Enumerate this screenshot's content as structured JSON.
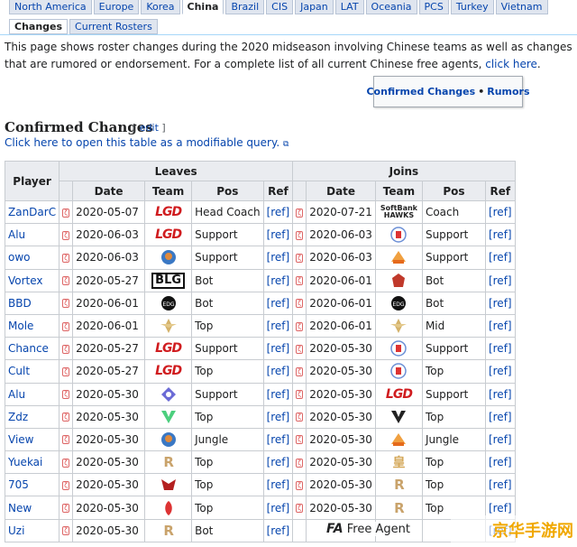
{
  "region_tabs": [
    "North America",
    "Europe",
    "Korea",
    "China",
    "Brazil",
    "CIS",
    "Japan",
    "LAT",
    "Oceania",
    "PCS",
    "Turkey",
    "Vietnam"
  ],
  "active_region": "China",
  "sub_tabs": [
    "Changes",
    "Current Rosters"
  ],
  "intro": {
    "text": "This page shows roster changes during the 2020 midseason involving Chinese teams as well as changes that are rumored or endorsement. For a complete list of all current Chinese free agents,",
    "link": "click here",
    "end": "."
  },
  "quicklinks": {
    "confirmed": "Confirmed Changes",
    "separator": "•",
    "rumors": "Rumors"
  },
  "section": {
    "title": "Confirmed Changes",
    "edit_open": "[",
    "edit": "edit",
    "edit_close": "]"
  },
  "query_link": "Click here to open this table as a modifiable query.",
  "table": {
    "player_header": "Player",
    "leaves_header": "Leaves",
    "joins_header": "Joins",
    "sub_headers": {
      "date": "Date",
      "team": "Team",
      "pos": "Pos",
      "ref": "Ref"
    },
    "rows": [
      {
        "player": "ZanDarC",
        "l_date": "2020-05-07",
        "l_team": "LGD",
        "l_pos": "Head Coach",
        "l_ref": "[ref]",
        "j_date": "2020-07-21",
        "j_team": "SoftBank HAWKS",
        "j_pos": "Coach",
        "j_ref": "[ref]"
      },
      {
        "player": "Alu",
        "l_date": "2020-06-03",
        "l_team": "LGD",
        "l_pos": "Support",
        "l_ref": "[ref]",
        "j_date": "2020-06-03",
        "j_team": "LNG",
        "j_pos": "Support",
        "j_ref": "[ref]"
      },
      {
        "player": "owo",
        "l_date": "2020-06-03",
        "l_team": "BLG",
        "l_pos": "Support",
        "l_ref": "[ref]",
        "j_date": "2020-06-03",
        "j_team": "Suning",
        "j_pos": "Support",
        "j_ref": "[ref]"
      },
      {
        "player": "Vortex",
        "l_date": "2020-05-27",
        "l_team": "BLG-wordmark",
        "l_pos": "Bot",
        "l_ref": "[ref]",
        "j_date": "2020-06-01",
        "j_team": "Dominus",
        "j_pos": "Bot",
        "j_ref": "[ref]"
      },
      {
        "player": "BBD",
        "l_date": "2020-06-01",
        "l_team": "EDG",
        "l_pos": "Bot",
        "l_ref": "[ref]",
        "j_date": "2020-06-01",
        "j_team": "EDG",
        "j_pos": "Bot",
        "j_ref": "[ref]"
      },
      {
        "player": "Mole",
        "l_date": "2020-06-01",
        "l_team": "FPX",
        "l_pos": "Top",
        "l_ref": "[ref]",
        "j_date": "2020-06-01",
        "j_team": "FPX",
        "j_pos": "Mid",
        "j_ref": "[ref]"
      },
      {
        "player": "Chance",
        "l_date": "2020-05-27",
        "l_team": "LGD",
        "l_pos": "Support",
        "l_ref": "[ref]",
        "j_date": "2020-05-30",
        "j_team": "LNG",
        "j_pos": "Support",
        "j_ref": "[ref]"
      },
      {
        "player": "Cult",
        "l_date": "2020-05-27",
        "l_team": "LGD",
        "l_pos": "Top",
        "l_ref": "[ref]",
        "j_date": "2020-05-30",
        "j_team": "LNG",
        "j_pos": "Top",
        "j_ref": "[ref]"
      },
      {
        "player": "Alu",
        "l_date": "2020-05-30",
        "l_team": "Rogue Warriors",
        "l_pos": "Support",
        "l_ref": "[ref]",
        "j_date": "2020-05-30",
        "j_team": "LGD",
        "j_pos": "Support",
        "j_ref": "[ref]"
      },
      {
        "player": "Zdz",
        "l_date": "2020-05-30",
        "l_team": "V5",
        "l_pos": "Top",
        "l_ref": "[ref]",
        "j_date": "2020-05-30",
        "j_team": "Victory Five",
        "j_pos": "Top",
        "j_ref": "[ref]"
      },
      {
        "player": "View",
        "l_date": "2020-05-30",
        "l_team": "BLG",
        "l_pos": "Jungle",
        "l_ref": "[ref]",
        "j_date": "2020-05-30",
        "j_team": "Suning",
        "j_pos": "Jungle",
        "j_ref": "[ref]"
      },
      {
        "player": "Yuekai",
        "l_date": "2020-05-30",
        "l_team": "RNG",
        "l_pos": "Top",
        "l_ref": "[ref]",
        "j_date": "2020-05-30",
        "j_team": "Royal",
        "j_pos": "Top",
        "j_ref": "[ref]"
      },
      {
        "player": "705",
        "l_date": "2020-05-30",
        "l_team": "JDG",
        "l_pos": "Top",
        "l_ref": "[ref]",
        "j_date": "2020-05-30",
        "j_team": "RNG",
        "j_pos": "Top",
        "j_ref": "[ref]"
      },
      {
        "player": "New",
        "l_date": "2020-05-30",
        "l_team": "OMG",
        "l_pos": "Top",
        "l_ref": "[ref]",
        "j_date": "2020-05-30",
        "j_team": "RNG",
        "j_pos": "Top",
        "j_ref": "[ref]"
      },
      {
        "player": "Uzi",
        "l_date": "2020-05-30",
        "l_team": "RNG",
        "l_pos": "Bot",
        "l_ref": "[ref]",
        "j_date": "",
        "j_team": "",
        "j_pos": "",
        "j_ref": "[ref]"
      }
    ]
  },
  "overlay": {
    "fa_mark": "FA",
    "fa_text": "Free Agent"
  },
  "watermark": "京华手游网",
  "colors": {
    "link": "#0645ad",
    "header_bg": "#eaecf0",
    "lgd_red": "#d01c1f",
    "rng_gold": "#c9a36b"
  }
}
